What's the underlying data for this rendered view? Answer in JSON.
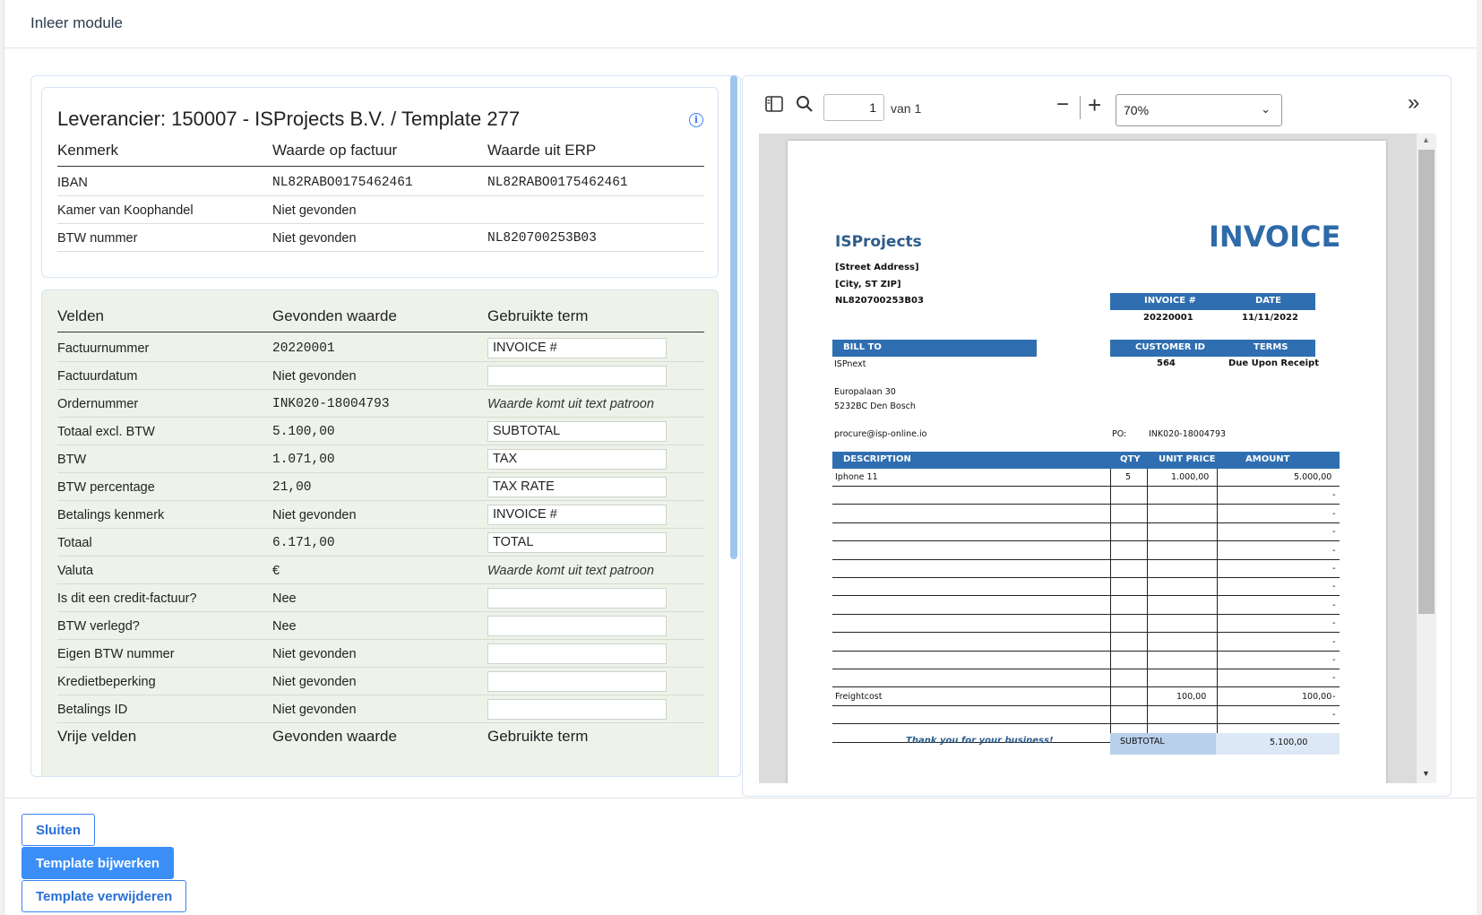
{
  "modal": {
    "title": "Inleer module"
  },
  "supplier": {
    "title": "Leverancier: 150007 - ISProjects B.V. / Template 277",
    "columns": [
      "Kenmerk",
      "Waarde op factuur",
      "Waarde uit ERP"
    ],
    "rows": [
      {
        "label": "IBAN",
        "invoice": "NL82RABO0175462461",
        "erp": "NL82RABO0175462461"
      },
      {
        "label": "Kamer van Koophandel",
        "invoice": "Niet gevonden",
        "erp": ""
      },
      {
        "label": "BTW nummer",
        "invoice": "Niet gevonden",
        "erp": "NL820700253B03"
      }
    ]
  },
  "fields": {
    "columns": [
      "Velden",
      "Gevonden waarde",
      "Gebruikte term"
    ],
    "rows": [
      {
        "label": "Factuurnummer",
        "value": "20220001",
        "term": "INVOICE #",
        "mono": true
      },
      {
        "label": "Factuurdatum",
        "value": "Niet gevonden",
        "term": ""
      },
      {
        "label": "Ordernummer",
        "value": "INK020-18004793",
        "note": "Waarde komt uit text patroon",
        "mono": true
      },
      {
        "label": "Totaal excl. BTW",
        "value": "5.100,00",
        "term": "SUBTOTAL",
        "mono": true
      },
      {
        "label": "BTW",
        "value": "1.071,00",
        "term": "TAX",
        "mono": true
      },
      {
        "label": "BTW percentage",
        "value": "21,00",
        "term": "TAX RATE",
        "mono": true
      },
      {
        "label": "Betalings kenmerk",
        "value": "Niet gevonden",
        "term": "INVOICE #"
      },
      {
        "label": "Totaal",
        "value": "6.171,00",
        "term": "TOTAL",
        "mono": true
      },
      {
        "label": "Valuta",
        "value": "€",
        "note": "Waarde komt uit text patroon"
      },
      {
        "label": "Is dit een credit-factuur?",
        "value": "Nee",
        "term": ""
      },
      {
        "label": "BTW verlegd?",
        "value": "Nee",
        "term": ""
      },
      {
        "label": "Eigen BTW nummer",
        "value": "Niet gevonden",
        "term": ""
      },
      {
        "label": "Kredietbeperking",
        "value": "Niet gevonden",
        "term": ""
      },
      {
        "label": "Betalings ID",
        "value": "Niet gevonden",
        "term": ""
      }
    ],
    "free_columns": [
      "Vrije velden",
      "Gevonden waarde",
      "Gebruikte term"
    ]
  },
  "pdf": {
    "page": "1",
    "of_label": "van 1",
    "zoom": "70%",
    "invoice": {
      "company": "ISProjects",
      "title": "INVOICE",
      "address1": "[Street Address]",
      "address2": "[City, ST  ZIP]",
      "vat": "NL820700253B03",
      "invoice_no_label": "INVOICE #",
      "date_label": "DATE",
      "invoice_no": "20220001",
      "date": "11/11/2022",
      "bill_to_label": "BILL TO",
      "customer_id_label": "CUSTOMER ID",
      "terms_label": "TERMS",
      "bill_to_name": "ISPnext",
      "customer_id": "564",
      "terms": "Due Upon Receipt",
      "bill_addr1": "Europalaan 30",
      "bill_addr2": "5232BC Den Bosch",
      "email": "procure@isp-online.io",
      "po_label": "PO:",
      "po": "INK020-18004793",
      "col_desc": "DESCRIPTION",
      "col_qty": "QTY",
      "col_unit": "UNIT PRICE",
      "col_amount": "AMOUNT",
      "line1_desc": "Iphone 11",
      "line1_qty": "5",
      "line1_unit": "1.000,00",
      "line1_amount": "5.000,00",
      "dash": "-",
      "freight_desc": "Freightcost",
      "freight_unit": "100,00",
      "freight_amount": "100,00",
      "thanks": "Thank you for your business!",
      "subtotal_label": "SUBTOTAL",
      "subtotal": "5.100,00"
    }
  },
  "buttons": {
    "close": "Sluiten",
    "update": "Template bijwerken",
    "delete": "Template verwijderen"
  },
  "colors": {
    "accent": "#3a8ef6",
    "invoice_blue": "#2f6eb0",
    "fields_bg": "#eef3ea"
  }
}
